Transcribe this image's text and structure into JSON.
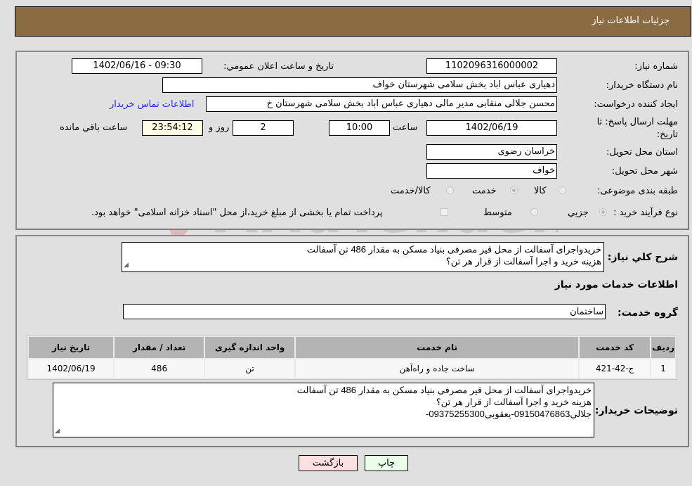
{
  "header": {
    "title": "جزئیات اطلاعات نیاز"
  },
  "watermark": {
    "text": "AriaTender.neT"
  },
  "details": {
    "need_number_label": "شماره نیاز:",
    "need_number": "1102096316000002",
    "announce_label": "تاریخ و ساعت اعلان عمومي:",
    "announce_value": "1402/06/16 - 09:30",
    "buyer_org_label": "نام دستگاه خریدار:",
    "buyer_org": "دهیاری عباس اباد بخش سلامی شهرستان خواف",
    "creator_label": "ایجاد کننده درخواست:",
    "creator": "محسن جلالی منقابی مدیر مالی دهیاری عباس اباد بخش سلامی شهرستان خ",
    "contact_link": "اطلاعات تماس خریدار",
    "deadline_label": "مهلت ارسال پاسخ: تا تاریخ:",
    "deadline_date": "1402/06/19",
    "time_label": "ساعت",
    "deadline_time": "10:00",
    "days_value": "2",
    "days_label": "روز و",
    "remaining_time": "23:54:12",
    "remaining_label": "ساعت باقي مانده",
    "province_label": "استان محل تحویل:",
    "province": "خراسان رضوی",
    "city_label": "شهر محل تحویل:",
    "city": "خواف",
    "category_label": "طبقه بندی موضوعی:",
    "category_options": [
      {
        "label": "کالا",
        "selected": false
      },
      {
        "label": "خدمت",
        "selected": true
      },
      {
        "label": "کالا/خدمت",
        "selected": false
      }
    ],
    "process_label": "نوع فرآیند خرید :",
    "process_options": [
      {
        "label": "جزيي",
        "selected": true
      },
      {
        "label": "متوسط",
        "selected": false
      }
    ],
    "treasury_note": "پرداخت تمام یا بخشی از مبلغ خرید،از محل \"اسناد خزانه اسلامی\" خواهد بود."
  },
  "description": {
    "label": "شرح کلي نياز:",
    "text": "خریدواجرای آسفالت از محل قیر مصرفی بنیاد مسکن به مقدار 486 تن آسفالت\nهزینه خرید و اجرا آسفالت از قرار هر تن؟"
  },
  "services": {
    "section_title": "اطلاعات خدمات مورد نیاز",
    "group_label": "گروه خدمت:",
    "group_value": "ساختمان",
    "columns": [
      "ردیف",
      "کد خدمت",
      "نام خدمت",
      "واحد اندازه گیری",
      "تعداد / مقدار",
      "تاریخ نیاز"
    ],
    "rows": [
      {
        "row": "1",
        "code": "ج-42-421",
        "name": "ساخت جاده و راه‌آهن",
        "unit": "تن",
        "qty": "486",
        "date": "1402/06/19"
      }
    ]
  },
  "buyer_notes": {
    "label": "توضیحات خریدار:",
    "text": "خریدواجرای آسفالت از محل قیر مصرفی بنیاد مسکن به مقدار 486 تن آسفالت\nهزینه خرید و اجرا آسفالت از قرار هر تن؟\nجلالی09150476863-یعقوبی09375255300-"
  },
  "buttons": {
    "print": "چاپ",
    "back": "بازگشت"
  },
  "colors": {
    "header_bg": "#8b6b42",
    "print_bg": "#eaffea",
    "back_bg": "#ffe0e0",
    "link": "#2a2aee"
  }
}
